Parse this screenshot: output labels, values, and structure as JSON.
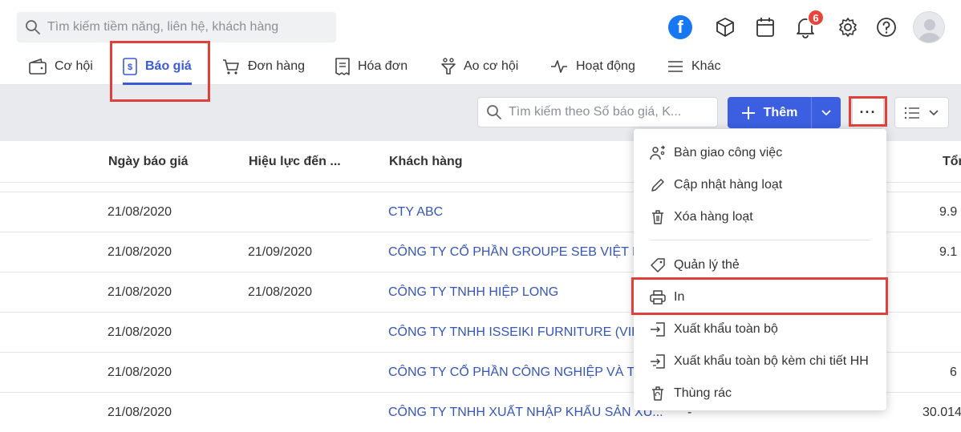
{
  "search": {
    "placeholder": "Tìm kiếm tiềm năng, liên hệ, khách hàng"
  },
  "header": {
    "icons": [
      "facebook-icon",
      "cube-icon",
      "calendar-icon",
      "bell-icon",
      "gear-icon",
      "help-icon",
      "avatar"
    ],
    "notification_count": "6"
  },
  "nav": {
    "items": [
      {
        "label": "Cơ hội",
        "icon": "wallet-icon"
      },
      {
        "label": "Báo giá",
        "icon": "quote-icon",
        "active": true
      },
      {
        "label": "Đơn hàng",
        "icon": "cart-icon"
      },
      {
        "label": "Hóa đơn",
        "icon": "invoice-icon"
      },
      {
        "label": "Ao cơ hội",
        "icon": "funnel-icon"
      },
      {
        "label": "Hoạt động",
        "icon": "activity-icon"
      },
      {
        "label": "Khác",
        "icon": "menu-icon"
      }
    ]
  },
  "toolbar": {
    "search_placeholder": "Tìm kiếm theo Số báo giá, K...",
    "add_label": "Thêm",
    "more_label": "···"
  },
  "table": {
    "columns": [
      "Ngày báo giá",
      "Hiệu lực đến ...",
      "Khách hàng",
      "Tổn"
    ],
    "rows": [
      {
        "date": "21/08/2020",
        "valid": "",
        "customer": "CTY ABC",
        "total": "9.9"
      },
      {
        "date": "21/08/2020",
        "valid": "21/09/2020",
        "customer": "CÔNG TY CỔ PHẦN GROUPE SEB VIỆT NA",
        "total": "9.1"
      },
      {
        "date": "21/08/2020",
        "valid": "21/08/2020",
        "customer": "CÔNG TY TNHH HIỆP LONG",
        "total": ""
      },
      {
        "date": "21/08/2020",
        "valid": "",
        "customer": "CÔNG TY TNHH ISSEIKI FURNITURE (VIỆT",
        "total": ""
      },
      {
        "date": "21/08/2020",
        "valid": "",
        "customer": "CÔNG TY CỔ PHẦN CÔNG NGHIỆP VÀ THƯ",
        "total": "6"
      },
      {
        "date": "21/08/2020",
        "valid": "",
        "customer": "CÔNG TY TNHH XUẤT NHẬP KHẨU SẢN XU...",
        "extra": "-",
        "total": "30.014"
      }
    ]
  },
  "menu": {
    "items": [
      {
        "label": "Bàn giao công việc",
        "icon": "handover-icon"
      },
      {
        "label": "Cập nhật hàng loạt",
        "icon": "pencil-icon"
      },
      {
        "label": "Xóa hàng loạt",
        "icon": "trash-icon"
      },
      {
        "label": "Quản lý thẻ",
        "icon": "tag-icon"
      },
      {
        "label": "In",
        "icon": "printer-icon"
      },
      {
        "label": "Xuất khẩu toàn bộ",
        "icon": "export-icon"
      },
      {
        "label": "Xuất khẩu toàn bộ kèm chi tiết HH",
        "icon": "export-detail-icon"
      },
      {
        "label": "Thùng rác",
        "icon": "recycle-bin-icon"
      }
    ]
  },
  "colors": {
    "accent": "#3b5fe0",
    "highlight": "#e0403a",
    "link": "#3556b8",
    "badge": "#e8453c"
  }
}
